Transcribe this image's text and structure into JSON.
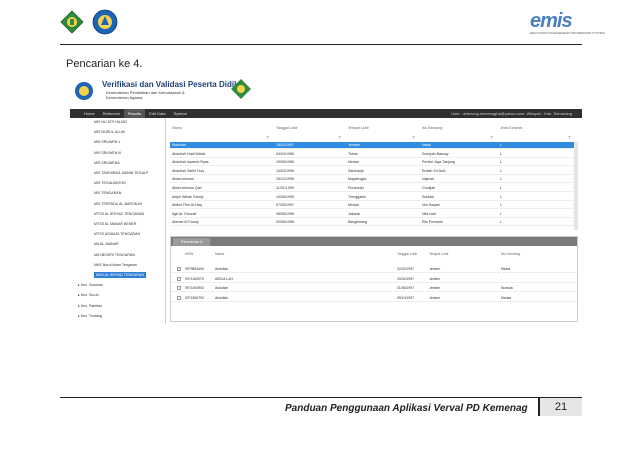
{
  "page": {
    "caption": "Pencarian ke 4.",
    "footer_text": "Panduan Penggunaan Aplikasi Verval PD Kemenag",
    "page_number": "21",
    "emis_logo_text": "emis",
    "emis_logo_sub": "EDUCATION MANAGEMENT INFORMATION SYSTEM"
  },
  "app": {
    "title": "Verifikasi dan Validasi Peserta Didik",
    "subtitle_1": "Kementerian Pendidikan dan Kebudayaan &",
    "subtitle_2": "Kementerian Agama",
    "menu": [
      "Home",
      "Referensi",
      "Results",
      "Edit Data",
      "System"
    ],
    "active_menu": "Results",
    "user_info": "User : afaerong.kemenagha@yahoo.com, Wilayah : Kab. Semarang"
  },
  "tree": {
    "items": [
      {
        "label": "MIS NU SITI HAJAR",
        "indent": 3,
        "expander": ""
      },
      {
        "label": "MIS NURUL ULUM",
        "indent": 3,
        "expander": ""
      },
      {
        "label": "MIS SRUWEN 1",
        "indent": 3,
        "expander": ""
      },
      {
        "label": "MIS SRUWEN III",
        "indent": 3,
        "expander": ""
      },
      {
        "label": "MIS SRUWENA",
        "indent": 3,
        "expander": ""
      },
      {
        "label": "MIS TAHDHIBUL BANIN TEGALP",
        "indent": 3,
        "expander": ""
      },
      {
        "label": "MIS TEGALWATON",
        "indent": 3,
        "expander": ""
      },
      {
        "label": "MIS TENGARAN",
        "indent": 3,
        "expander": ""
      },
      {
        "label": "MIS TERPADU AL-BAROKAH",
        "indent": 3,
        "expander": ""
      },
      {
        "label": "MTSS AL IRSYAD TENGARAN",
        "indent": 3,
        "expander": ""
      },
      {
        "label": "MTSS AL MANAR BENER",
        "indent": 3,
        "expander": ""
      },
      {
        "label": "MTSS ASWAJA TENGARAN",
        "indent": 3,
        "expander": ""
      },
      {
        "label": "MA AL-MANAR",
        "indent": 3,
        "expander": ""
      },
      {
        "label": "MA NEGERI TENGARAN",
        "indent": 3,
        "expander": ""
      },
      {
        "label": "MAS Nurul Islam Tengaran",
        "indent": 3,
        "expander": ""
      },
      {
        "label": "MAS AL IRSYAD TENGARAN",
        "indent": 3,
        "expander": "",
        "selected": true
      },
      {
        "label": "Kec. Susukan",
        "indent": 1,
        "expander": "▸"
      },
      {
        "label": "Kec. Suruh",
        "indent": 1,
        "expander": "▸"
      },
      {
        "label": "Kec. Pabelan",
        "indent": 1,
        "expander": "▸"
      },
      {
        "label": "Kec. Tuntang",
        "indent": 1,
        "expander": "▸"
      }
    ]
  },
  "grid": {
    "columns": [
      "Nama",
      "Tanggal Lahir",
      "Tempat Lahir",
      "Ibu Kandung",
      "Jenis Kelamin"
    ],
    "rows": [
      {
        "nama": "Abdullah",
        "tgl": "15/02/1997",
        "tempat": "Jember",
        "ibu": "Nada",
        "jk": "L",
        "selected": true
      },
      {
        "nama": "Abdullah Hadi Wahid",
        "tgl": "04/04/1996",
        "tempat": "Tuban",
        "ibu": "Sowiyah Basuay",
        "jk": "L"
      },
      {
        "nama": "Abdullah Iswanto Ryas",
        "tgl": "19/06/1996",
        "tempat": "Medan",
        "ibu": "Pertiwi Jaya Tanjung",
        "jk": "L"
      },
      {
        "nama": "Abdullah Saiful Huq",
        "tgl": "10/04/1996",
        "tempat": "Salohanje",
        "ibu": "Endah Sri Asih",
        "jk": "L"
      },
      {
        "nama": "Abdurrahman",
        "tgl": "25/12/1995",
        "tempat": "Majalengka",
        "ibu": "Najmah",
        "jk": "L"
      },
      {
        "nama": "Abdurrahman Qari",
        "tgl": "11/01/1995",
        "tempat": "Purworejo",
        "ibu": "Chotijah",
        "jk": "L"
      },
      {
        "nama": "Adyin Wihan Sandy",
        "tgl": "10/08/1995",
        "tempat": "Trenggalek",
        "ibu": "Sulastri",
        "jk": "L"
      },
      {
        "nama": "Afdhol Fikri Al-Haq",
        "tgl": "07/05/1997",
        "tempat": "Medan",
        "ibu": "Nur Hayani",
        "jk": "L"
      },
      {
        "nama": "Agil AL Ghuzali",
        "tgl": "08/08/1996",
        "tempat": "Jakarta",
        "ibu": "Nila wati",
        "jk": "L"
      },
      {
        "nama": "Ahmad Al Faruqi",
        "tgl": "30/06/1996",
        "tempat": "Bangkinang",
        "ibu": "Elis Purwanti",
        "jk": "L"
      }
    ]
  },
  "panel": {
    "tab_label": "Pencarian 4",
    "columns": [
      "NISN",
      "Nama",
      "Tanggal Lahir",
      "Tempat Lahir",
      "Ibu Kandung"
    ],
    "rows": [
      {
        "nisn": "9979804490",
        "nama": "Abdullah",
        "tgl": "02/02/1997",
        "tempat": "Jember",
        "ibu": "Miona"
      },
      {
        "nisn": "9971165575",
        "nama": "ABDULLAH",
        "tgl": "20/02/1997",
        "tempat": "Jember",
        "ibu": "-"
      },
      {
        "nisn": "9971400953",
        "nama": "Abdullah",
        "tgl": "01/05/1997",
        "tempat": "Jember",
        "ibu": "Nursida"
      },
      {
        "nisn": "9971806790",
        "nama": "Abdullah",
        "tgl": "09/10/1997",
        "tempat": "Jember",
        "ibu": "Marisa"
      }
    ]
  },
  "colors": {
    "selection_blue": "#2f8ce0",
    "menubar": "#2f2f2f",
    "emis_blue": "#4a7fc1"
  }
}
